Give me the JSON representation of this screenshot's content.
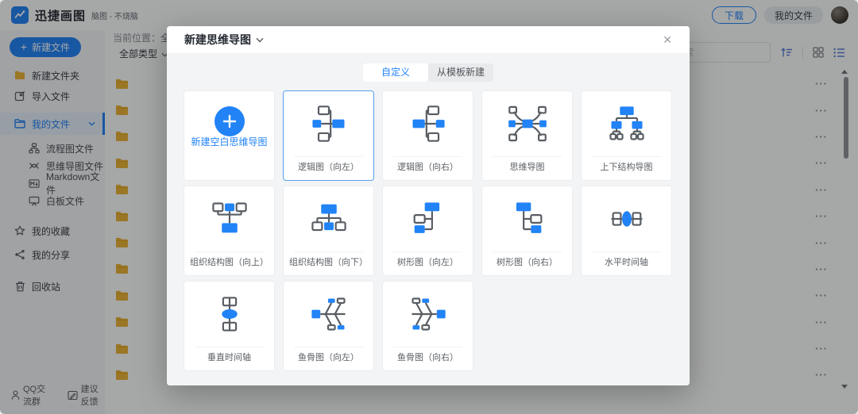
{
  "icons": {
    "plus": "+",
    "close": "✕",
    "more": "···"
  },
  "colors": {
    "primary": "#2183f6",
    "folder": "#ecb234",
    "selected_border": "#57a0f2"
  },
  "header": {
    "app_name": "迅捷画图",
    "tagline": "脑图 - 不烧脑",
    "download_label": "下载",
    "my_files_label": "我的文件"
  },
  "toolbar": {
    "location_label": "当前位置：",
    "location_value": "全部文件",
    "type_filter": "全部类型",
    "search_placeholder": "输入文件名搜索"
  },
  "sidebar": {
    "new_file_button": "新建文件",
    "items": [
      {
        "key": "new-folder",
        "icon": "folder-yellow",
        "label": "新建文件夹"
      },
      {
        "key": "import-file",
        "icon": "import",
        "label": "导入文件"
      },
      {
        "key": "my-files",
        "icon": "folder-blue",
        "label": "我的文件",
        "active": true
      },
      {
        "key": "flowchart-files",
        "icon": "flowchart",
        "label": "流程图文件",
        "indent": true,
        "first_sub": true
      },
      {
        "key": "mindmap-files",
        "icon": "mindmap",
        "label": "思维导图文件",
        "indent": true
      },
      {
        "key": "markdown-files",
        "icon": "markdown",
        "label": "Markdown文件",
        "indent": true
      },
      {
        "key": "whiteboard-files",
        "icon": "whiteboard",
        "label": "白板文件",
        "indent": true
      },
      {
        "key": "favorites",
        "icon": "star",
        "label": "我的收藏",
        "gap": "lg"
      },
      {
        "key": "shares",
        "icon": "share",
        "label": "我的分享",
        "gap": "sm"
      },
      {
        "key": "recycle-bin",
        "icon": "trash",
        "label": "回收站",
        "gap": "lg"
      }
    ],
    "footer": [
      {
        "key": "qq-group",
        "icon": "qq",
        "label": "QQ交流群"
      },
      {
        "key": "feedback",
        "icon": "feedback",
        "label": "建议反馈"
      }
    ]
  },
  "file_list": {
    "row_count": 12
  },
  "modal": {
    "title": "新建思维导图",
    "tabs": [
      {
        "key": "custom",
        "label": "自定义",
        "active": true
      },
      {
        "key": "from-template",
        "label": "从模板新建",
        "active": false
      }
    ],
    "cards": [
      {
        "key": "blank",
        "type": "blank",
        "label": "新建空白思维导图"
      },
      {
        "key": "logic-left",
        "type": "logic-left",
        "label": "逻辑图（向左）",
        "selected": true
      },
      {
        "key": "logic-right",
        "type": "logic-right",
        "label": "逻辑图（向右）"
      },
      {
        "key": "mindmap",
        "type": "mindmap",
        "label": "思维导图"
      },
      {
        "key": "top-down",
        "type": "top-down",
        "label": "上下结构导图"
      },
      {
        "key": "org-up",
        "type": "org-up",
        "label": "组织结构图（向上）"
      },
      {
        "key": "org-down",
        "type": "org-down",
        "label": "组织结构图（向下）"
      },
      {
        "key": "tree-left",
        "type": "tree-left",
        "label": "树形图（向左）"
      },
      {
        "key": "tree-right",
        "type": "tree-right",
        "label": "树形图（向右）"
      },
      {
        "key": "timeline-h",
        "type": "timeline-h",
        "label": "水平时间轴"
      },
      {
        "key": "timeline-v",
        "type": "timeline-v",
        "label": "垂直时间轴"
      },
      {
        "key": "fishbone-left",
        "type": "fishbone-left",
        "label": "鱼骨图（向左）"
      },
      {
        "key": "fishbone-right",
        "type": "fishbone-right",
        "label": "鱼骨图（向右）"
      }
    ]
  }
}
